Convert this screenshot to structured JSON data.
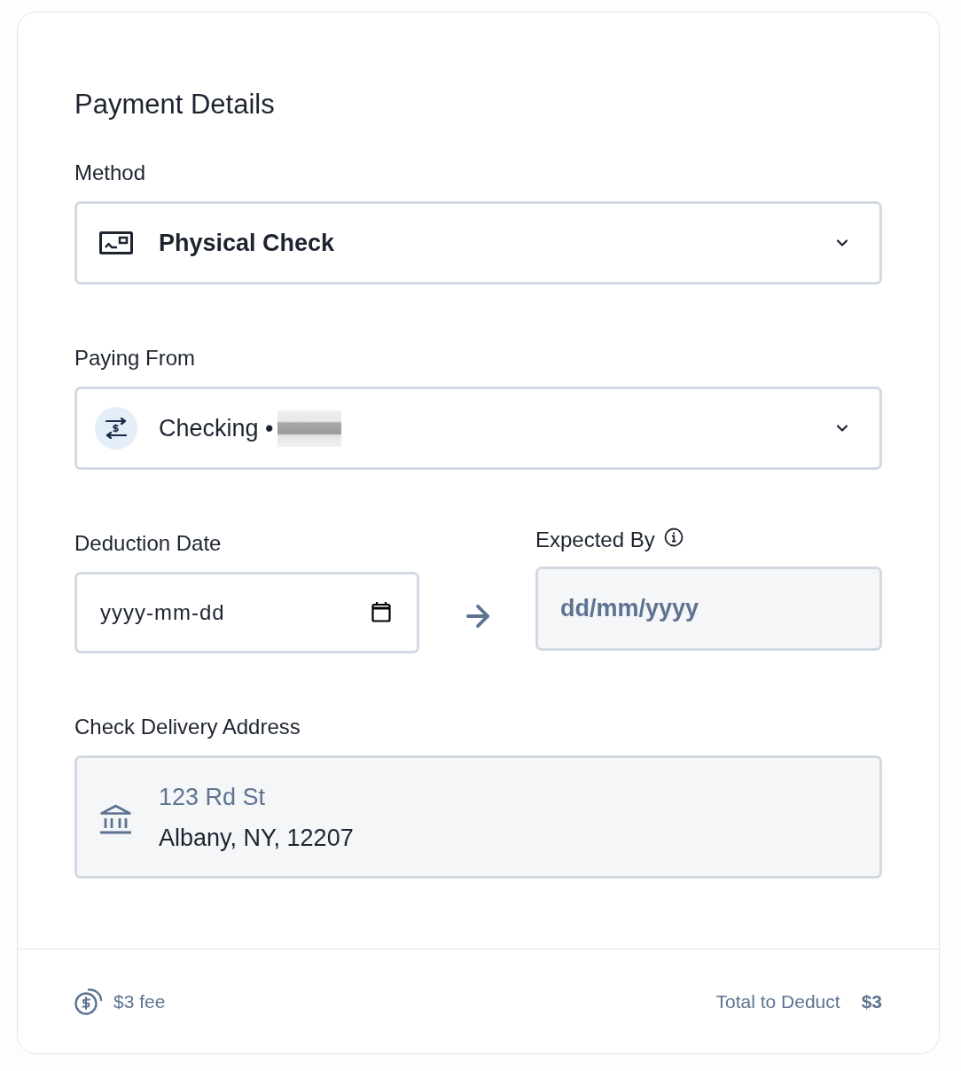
{
  "title": "Payment Details",
  "method": {
    "label": "Method",
    "value": "Physical Check"
  },
  "paying_from": {
    "label": "Paying From",
    "value": "Checking •"
  },
  "deduction_date": {
    "label": "Deduction Date",
    "placeholder": "yyyy-mm-dd"
  },
  "expected_by": {
    "label": "Expected By",
    "placeholder": "dd/mm/yyyy",
    "disabled": true
  },
  "delivery_address": {
    "label": "Check Delivery Address",
    "line_1": "123 Rd St",
    "line_2": "Albany, NY, 12207"
  },
  "footer": {
    "fee": "$3 fee",
    "total_label": "Total to Deduct",
    "total": "$3"
  }
}
